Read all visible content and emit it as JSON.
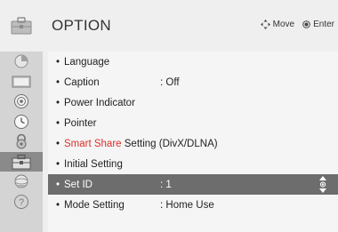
{
  "header": {
    "title": "OPTION",
    "hints": [
      {
        "icon": "move-arrows-icon",
        "label": "Move"
      },
      {
        "icon": "enter-dot-icon",
        "label": "Enter"
      }
    ]
  },
  "sidebar": {
    "items": [
      {
        "icon": "picture-icon"
      },
      {
        "icon": "screen-icon"
      },
      {
        "icon": "speaker-icon"
      },
      {
        "icon": "clock-icon"
      },
      {
        "icon": "lock-icon"
      },
      {
        "icon": "option-icon",
        "active": true
      },
      {
        "icon": "network-icon"
      },
      {
        "icon": "help-icon"
      }
    ]
  },
  "menu": {
    "items": [
      {
        "label": "Language",
        "value": ""
      },
      {
        "label": "Caption",
        "value": ": Off"
      },
      {
        "label": "Power Indicator",
        "value": ""
      },
      {
        "label": "Pointer",
        "value": ""
      },
      {
        "label_highlight": "Smart Share",
        "label_rest": " Setting (DivX/DLNA)",
        "value": ""
      },
      {
        "label": "Initial Setting",
        "value": ""
      },
      {
        "label": "Set ID",
        "value": ": 1",
        "selected": true
      },
      {
        "label": "Mode Setting",
        "value": ": Home Use"
      }
    ]
  },
  "colors": {
    "highlight": "#d9302c",
    "selected_row": "#6d6d6d",
    "sidebar_active": "#8a8a8a"
  }
}
